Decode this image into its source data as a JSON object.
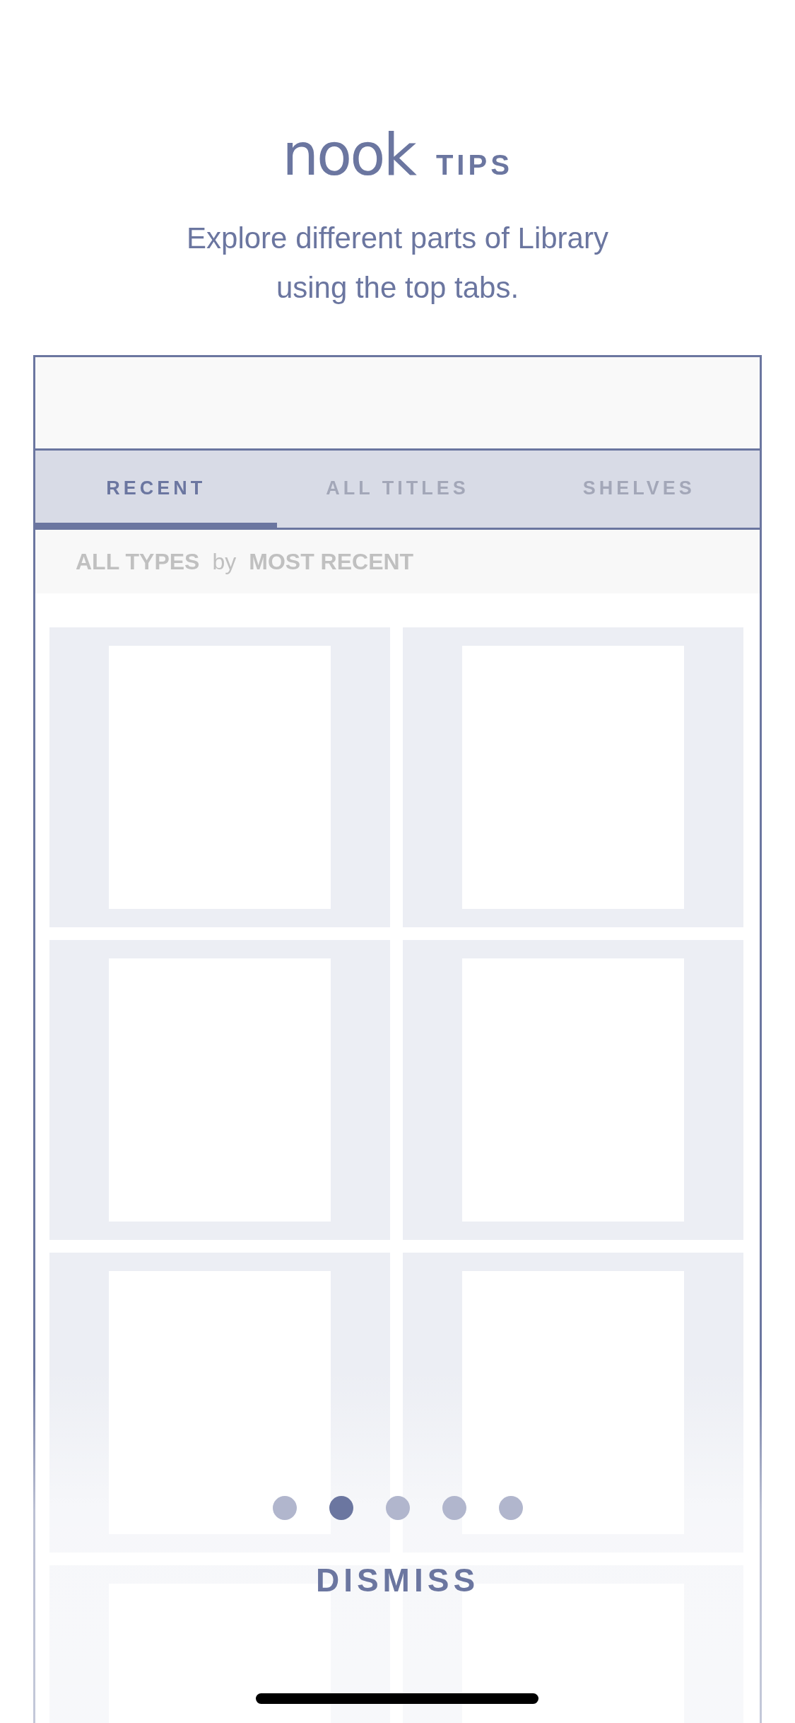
{
  "header": {
    "brand": "nook",
    "badge": "TIPS",
    "message": "Explore different parts of Library using the top tabs."
  },
  "preview": {
    "tabs": [
      {
        "label": "RECENT",
        "selected": true
      },
      {
        "label": "ALL TITLES",
        "selected": false
      },
      {
        "label": "SHELVES",
        "selected": false
      }
    ],
    "filter": {
      "type": "ALL TYPES",
      "joiner": "by",
      "sort": "MOST RECENT"
    },
    "tiles": [
      {
        "kind": "placeholder"
      },
      {
        "kind": "placeholder"
      },
      {
        "kind": "placeholder"
      },
      {
        "kind": "placeholder"
      },
      {
        "kind": "placeholder"
      },
      {
        "kind": "placeholder"
      },
      {
        "kind": "placeholder"
      },
      {
        "kind": "placeholder"
      }
    ]
  },
  "pager": [
    {
      "selected": false
    },
    {
      "selected": true
    },
    {
      "selected": false
    },
    {
      "selected": false
    },
    {
      "selected": false
    }
  ],
  "dismiss": "DISMISS"
}
